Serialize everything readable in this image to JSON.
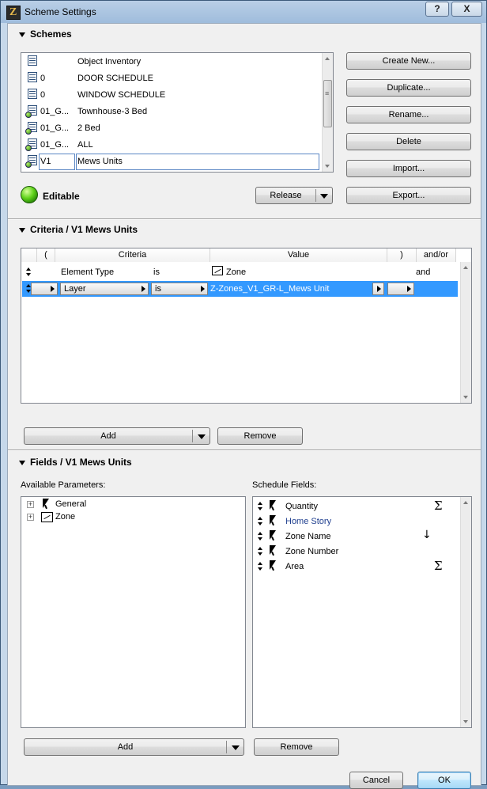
{
  "window": {
    "title": "Scheme Settings",
    "help_label": "?",
    "close_label": "X"
  },
  "schemes": {
    "section_title": "Schemes",
    "items": [
      {
        "id": "",
        "name": "Object Inventory"
      },
      {
        "id": "0",
        "name": "DOOR SCHEDULE"
      },
      {
        "id": "0",
        "name": "WINDOW SCHEDULE"
      },
      {
        "id": "01_G...",
        "name": "Townhouse-3 Bed"
      },
      {
        "id": "01_G...",
        "name": "2 Bed"
      },
      {
        "id": "01_G...",
        "name": "ALL"
      },
      {
        "id": "V1",
        "name": "Mews Units"
      }
    ],
    "buttons": {
      "create_new": "Create New...",
      "duplicate": "Duplicate...",
      "rename": "Rename...",
      "delete": "Delete",
      "import": "Import...",
      "export": "Export..."
    },
    "status_label": "Editable",
    "release_label": "Release"
  },
  "criteria": {
    "section_title": "Criteria / V1 Mews Units",
    "headers": {
      "open_paren": "(",
      "criteria": "Criteria",
      "value": "Value",
      "close_paren": ")",
      "and_or": "and/or"
    },
    "rows": [
      {
        "criteria": "Element Type",
        "op": "is",
        "value": "Zone",
        "and_or": "and"
      },
      {
        "criteria": "Layer",
        "op": "is",
        "value": "Z-Zones_V1_GR-L_Mews Unit",
        "and_or": ""
      }
    ],
    "add_label": "Add",
    "remove_label": "Remove"
  },
  "fields": {
    "section_title": "Fields / V1 Mews Units",
    "available_label": "Available Parameters:",
    "schedule_label": "Schedule Fields:",
    "available": [
      {
        "name": "General",
        "icon": "cursor-icon"
      },
      {
        "name": "Zone",
        "icon": "zone-icon"
      }
    ],
    "schedule": [
      {
        "name": "Quantity",
        "marker": "Σ"
      },
      {
        "name": "Home Story",
        "marker": ""
      },
      {
        "name": "Zone Name",
        "marker": "↓"
      },
      {
        "name": "Zone Number",
        "marker": ""
      },
      {
        "name": "Area",
        "marker": "Σ"
      }
    ],
    "add_label": "Add",
    "remove_label": "Remove"
  },
  "footer": {
    "cancel_label": "Cancel",
    "ok_label": "OK"
  },
  "colors": {
    "selection": "#3399ff",
    "home_story_text": "#1f3f8f"
  }
}
